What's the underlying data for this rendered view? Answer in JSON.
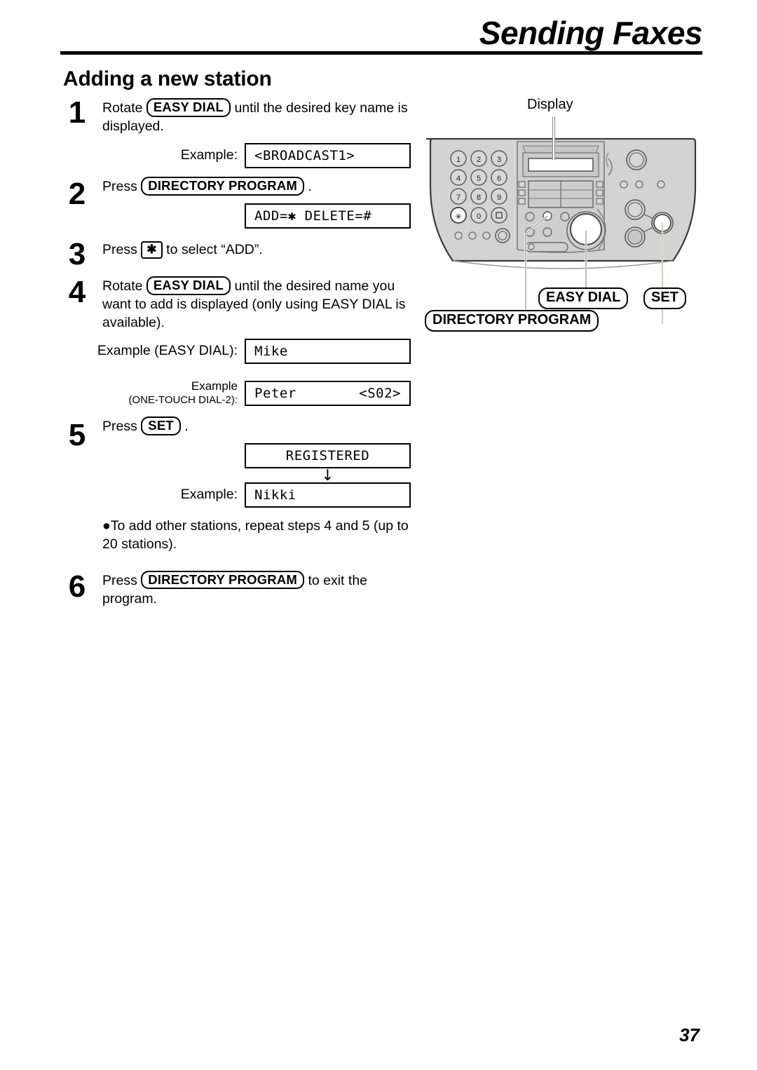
{
  "header": {
    "title": "Sending Faxes"
  },
  "section": {
    "heading": "Adding a new station"
  },
  "steps": [
    {
      "number": "1",
      "text_before": "Rotate",
      "key": "EASY DIAL",
      "text_after": "until the desired key name is displayed.",
      "example_label": "Example:",
      "lcd": "<BROADCAST1>"
    },
    {
      "number": "2",
      "text_before": "Press",
      "key": "DIRECTORY PROGRAM",
      "text_after": ".",
      "lcd": "ADD=✱ DELETE=#"
    },
    {
      "number": "3",
      "text_before": "Press",
      "key": "✱",
      "text_after": "to select “ADD”."
    },
    {
      "number": "4",
      "text_before": "Rotate",
      "key": "EASY DIAL",
      "text_after": "until the desired name you want to add is displayed (only using EASY DIAL is available).",
      "example_label_1": "Example (EASY DIAL):",
      "lcd_1": "Mike",
      "example_label_2a": "Example",
      "example_label_2b": "(ONE-TOUCH DIAL-2):",
      "lcd_2_left": "Peter",
      "lcd_2_right": "<S02>"
    },
    {
      "number": "5",
      "text_before": "Press",
      "key": "SET",
      "text_after": ".",
      "lcd_1": "REGISTERED",
      "arrow": "↓",
      "example_label": "Example:",
      "lcd_2": "Nikki",
      "note": "●To add other stations, repeat steps 4 and 5 (up to 20 stations)."
    },
    {
      "number": "6",
      "text_before": "Press",
      "key": "DIRECTORY PROGRAM",
      "text_after": "to exit the program."
    }
  ],
  "figure": {
    "display_label": "Display",
    "callouts": {
      "easy_dial": "EASY DIAL",
      "set": "SET",
      "directory_program": "DIRECTORY PROGRAM"
    },
    "keypad": [
      "1",
      "2",
      "3",
      "4",
      "5",
      "6",
      "7",
      "8",
      "9",
      "✱",
      "0",
      "⊡"
    ],
    "colors": {
      "body": "#d3d3d3",
      "body_dark": "#b9b9b9",
      "outline": "#3a3a3a",
      "lcd": "#ffffff",
      "highlight": "#ffffff"
    }
  },
  "page_number": "37"
}
